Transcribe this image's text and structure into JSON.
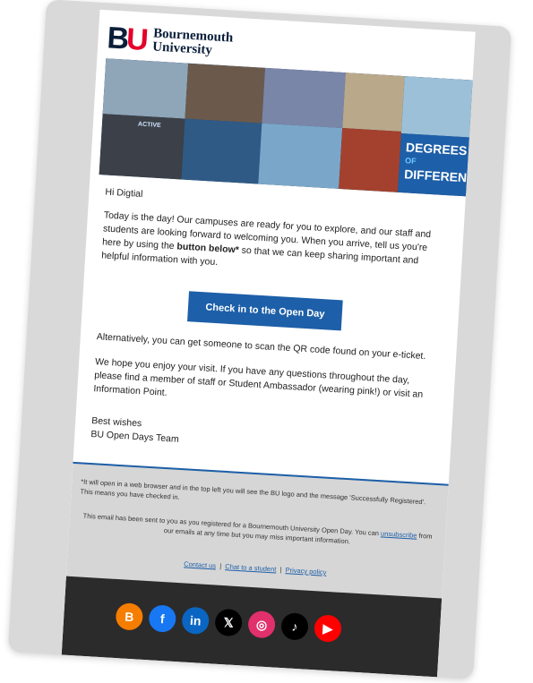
{
  "logo": {
    "mark_b": "B",
    "mark_u": "U",
    "line1": "Bournemouth",
    "line2": "University"
  },
  "banner": {
    "active_label": "ACTIVE",
    "degrees_line1": "DEGREES",
    "degrees_of": "OF",
    "degrees_line2": "DIFFERENCE"
  },
  "greeting": "Hi Digtial",
  "para1_a": "Today is the day! Our campuses are ready for you to explore, and our staff and students are looking forward to welcoming you. When you arrive, tell us you're here by using the ",
  "para1_bold": "button below*",
  "para1_b": " so that we can keep sharing important and helpful information with you.",
  "cta_label": "Check in to the Open Day",
  "para2": "Alternatively, you can get someone to scan the QR code found on your e-ticket.",
  "para3": "We hope you enjoy your visit. If you have any questions throughout the day, please find a member of staff or Student Ambassador (wearing pink!) or visit an Information Point.",
  "signoff1": "Best wishes",
  "signoff2": "BU Open Days Team",
  "footnote": "*It will open in a web browser and in the top left you will see the BU logo and the message 'Successfully Registered'. This means you have checked in.",
  "notice_a": "This email has been sent to you as you registered for a Bournemouth University Open Day. You can ",
  "notice_link": "unsubscribe",
  "notice_b": " from our emails at any time but you may miss important information.",
  "links": {
    "contact": "Contact us",
    "chat": "Chat to a student",
    "privacy": "Privacy policy",
    "sep": "|"
  },
  "socials": [
    {
      "name": "blogger-icon",
      "glyph": "B",
      "color": "#f57d00"
    },
    {
      "name": "facebook-icon",
      "glyph": "f",
      "color": "#1877f2"
    },
    {
      "name": "linkedin-icon",
      "glyph": "in",
      "color": "#0a66c2"
    },
    {
      "name": "x-icon",
      "glyph": "𝕏",
      "color": "#000000"
    },
    {
      "name": "instagram-icon",
      "glyph": "◎",
      "color": "#e1306c"
    },
    {
      "name": "tiktok-icon",
      "glyph": "♪",
      "color": "#000000"
    },
    {
      "name": "youtube-icon",
      "glyph": "▶",
      "color": "#ff0000"
    }
  ],
  "colors": {
    "brand_blue": "#1d5fa8",
    "navy": "#0b1f3a",
    "bu_red": "#e4002b"
  }
}
